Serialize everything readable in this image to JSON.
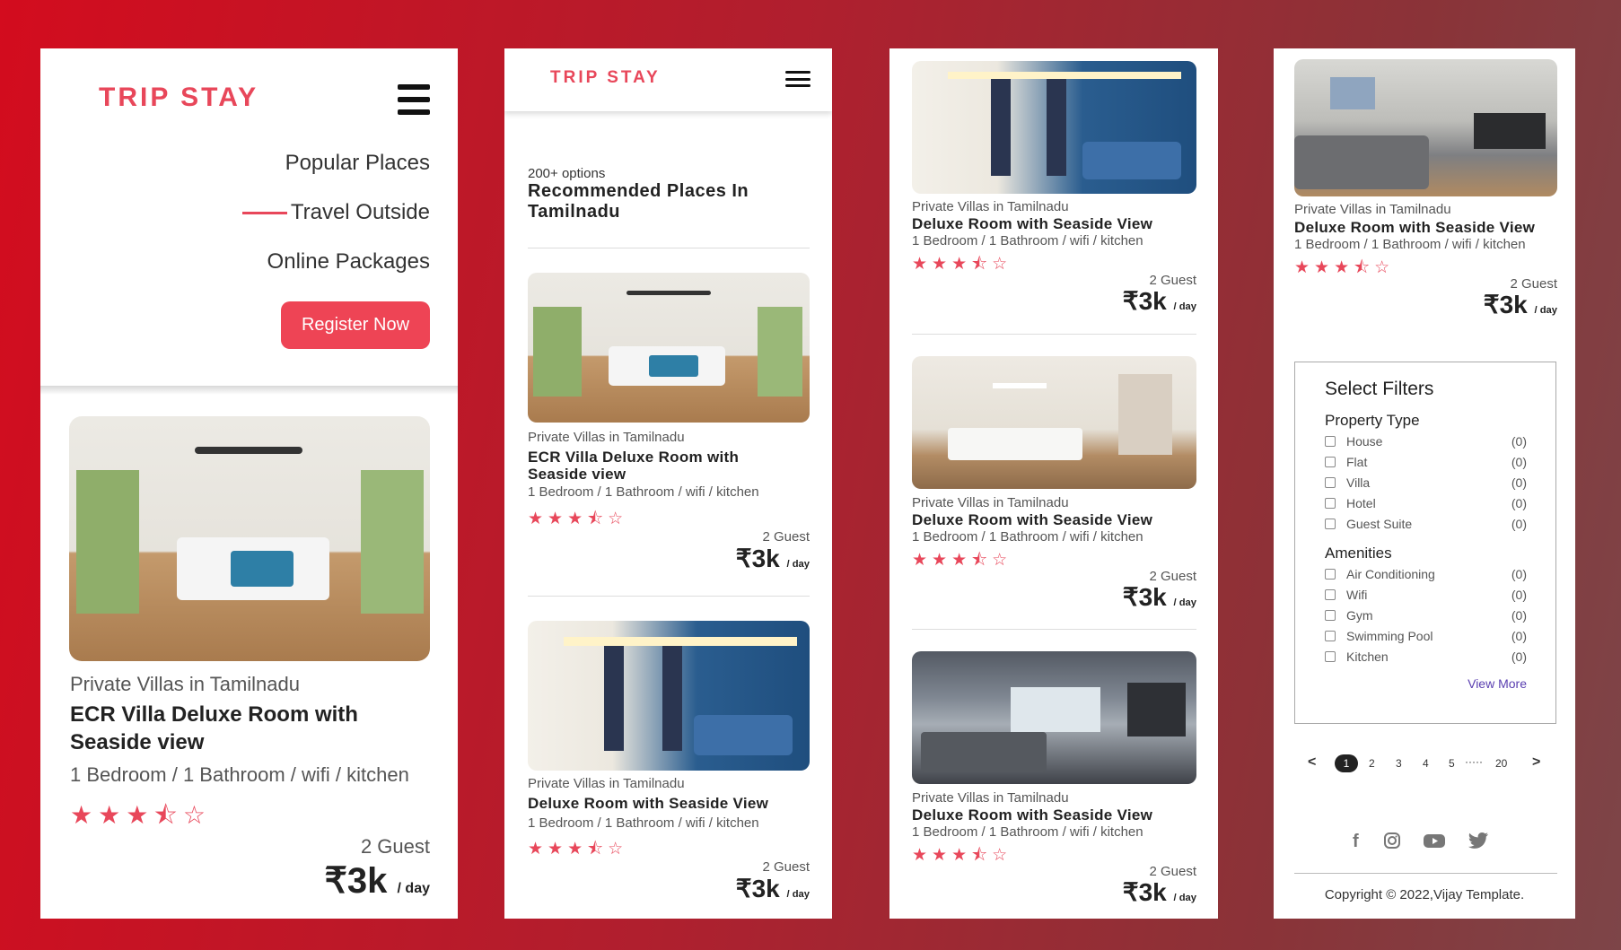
{
  "brand": "TRIP STAY",
  "colors": {
    "accent": "#e8475a",
    "button": "#ee4455"
  },
  "nav": {
    "items": [
      "Popular Places",
      "Travel Outside",
      "Online Packages"
    ],
    "register": "Register Now"
  },
  "panel2": {
    "options": "200+ options",
    "heading": "Recommended Places In Tamilnadu"
  },
  "card_featured": {
    "sub": "Private Villas in Tamilnadu",
    "title": "ECR Villa Deluxe Room with Seaside view",
    "features": "1 Bedroom / 1 Bathroom / wifi / kitchen",
    "rating": 3.5,
    "guests": "2 Guest",
    "price": "₹3k",
    "per": "/ day"
  },
  "card_deluxe": {
    "sub": "Private Villas in Tamilnadu",
    "title": "Deluxe Room with Seaside View",
    "features": "1 Bedroom / 1 Bathroom / wifi / kitchen",
    "rating": 3.5,
    "guests": "2 Guest",
    "price": "₹3k",
    "per": "/ day"
  },
  "filters": {
    "title": "Select Filters",
    "property_type": {
      "label": "Property Type",
      "options": [
        {
          "label": "House",
          "count": "(0)"
        },
        {
          "label": "Flat",
          "count": "(0)"
        },
        {
          "label": "Villa",
          "count": "(0)"
        },
        {
          "label": "Hotel",
          "count": "(0)"
        },
        {
          "label": "Guest Suite",
          "count": "(0)"
        }
      ]
    },
    "amenities": {
      "label": "Amenities",
      "options": [
        {
          "label": "Air Conditioning",
          "count": "(0)"
        },
        {
          "label": "Wifi",
          "count": "(0)"
        },
        {
          "label": "Gym",
          "count": "(0)"
        },
        {
          "label": "Swimming Pool",
          "count": "(0)"
        },
        {
          "label": "Kitchen",
          "count": "(0)"
        }
      ]
    },
    "view_more": "View More"
  },
  "pagination": {
    "prev": "<",
    "next": ">",
    "pages": [
      "1",
      "2",
      "3",
      "4",
      "5"
    ],
    "ellipsis": "·····",
    "last": "20",
    "active": "1"
  },
  "social_icons": [
    "facebook-icon",
    "instagram-icon",
    "youtube-icon",
    "twitter-icon"
  ],
  "copyright": "Copyright © 2022,Vijay Template."
}
